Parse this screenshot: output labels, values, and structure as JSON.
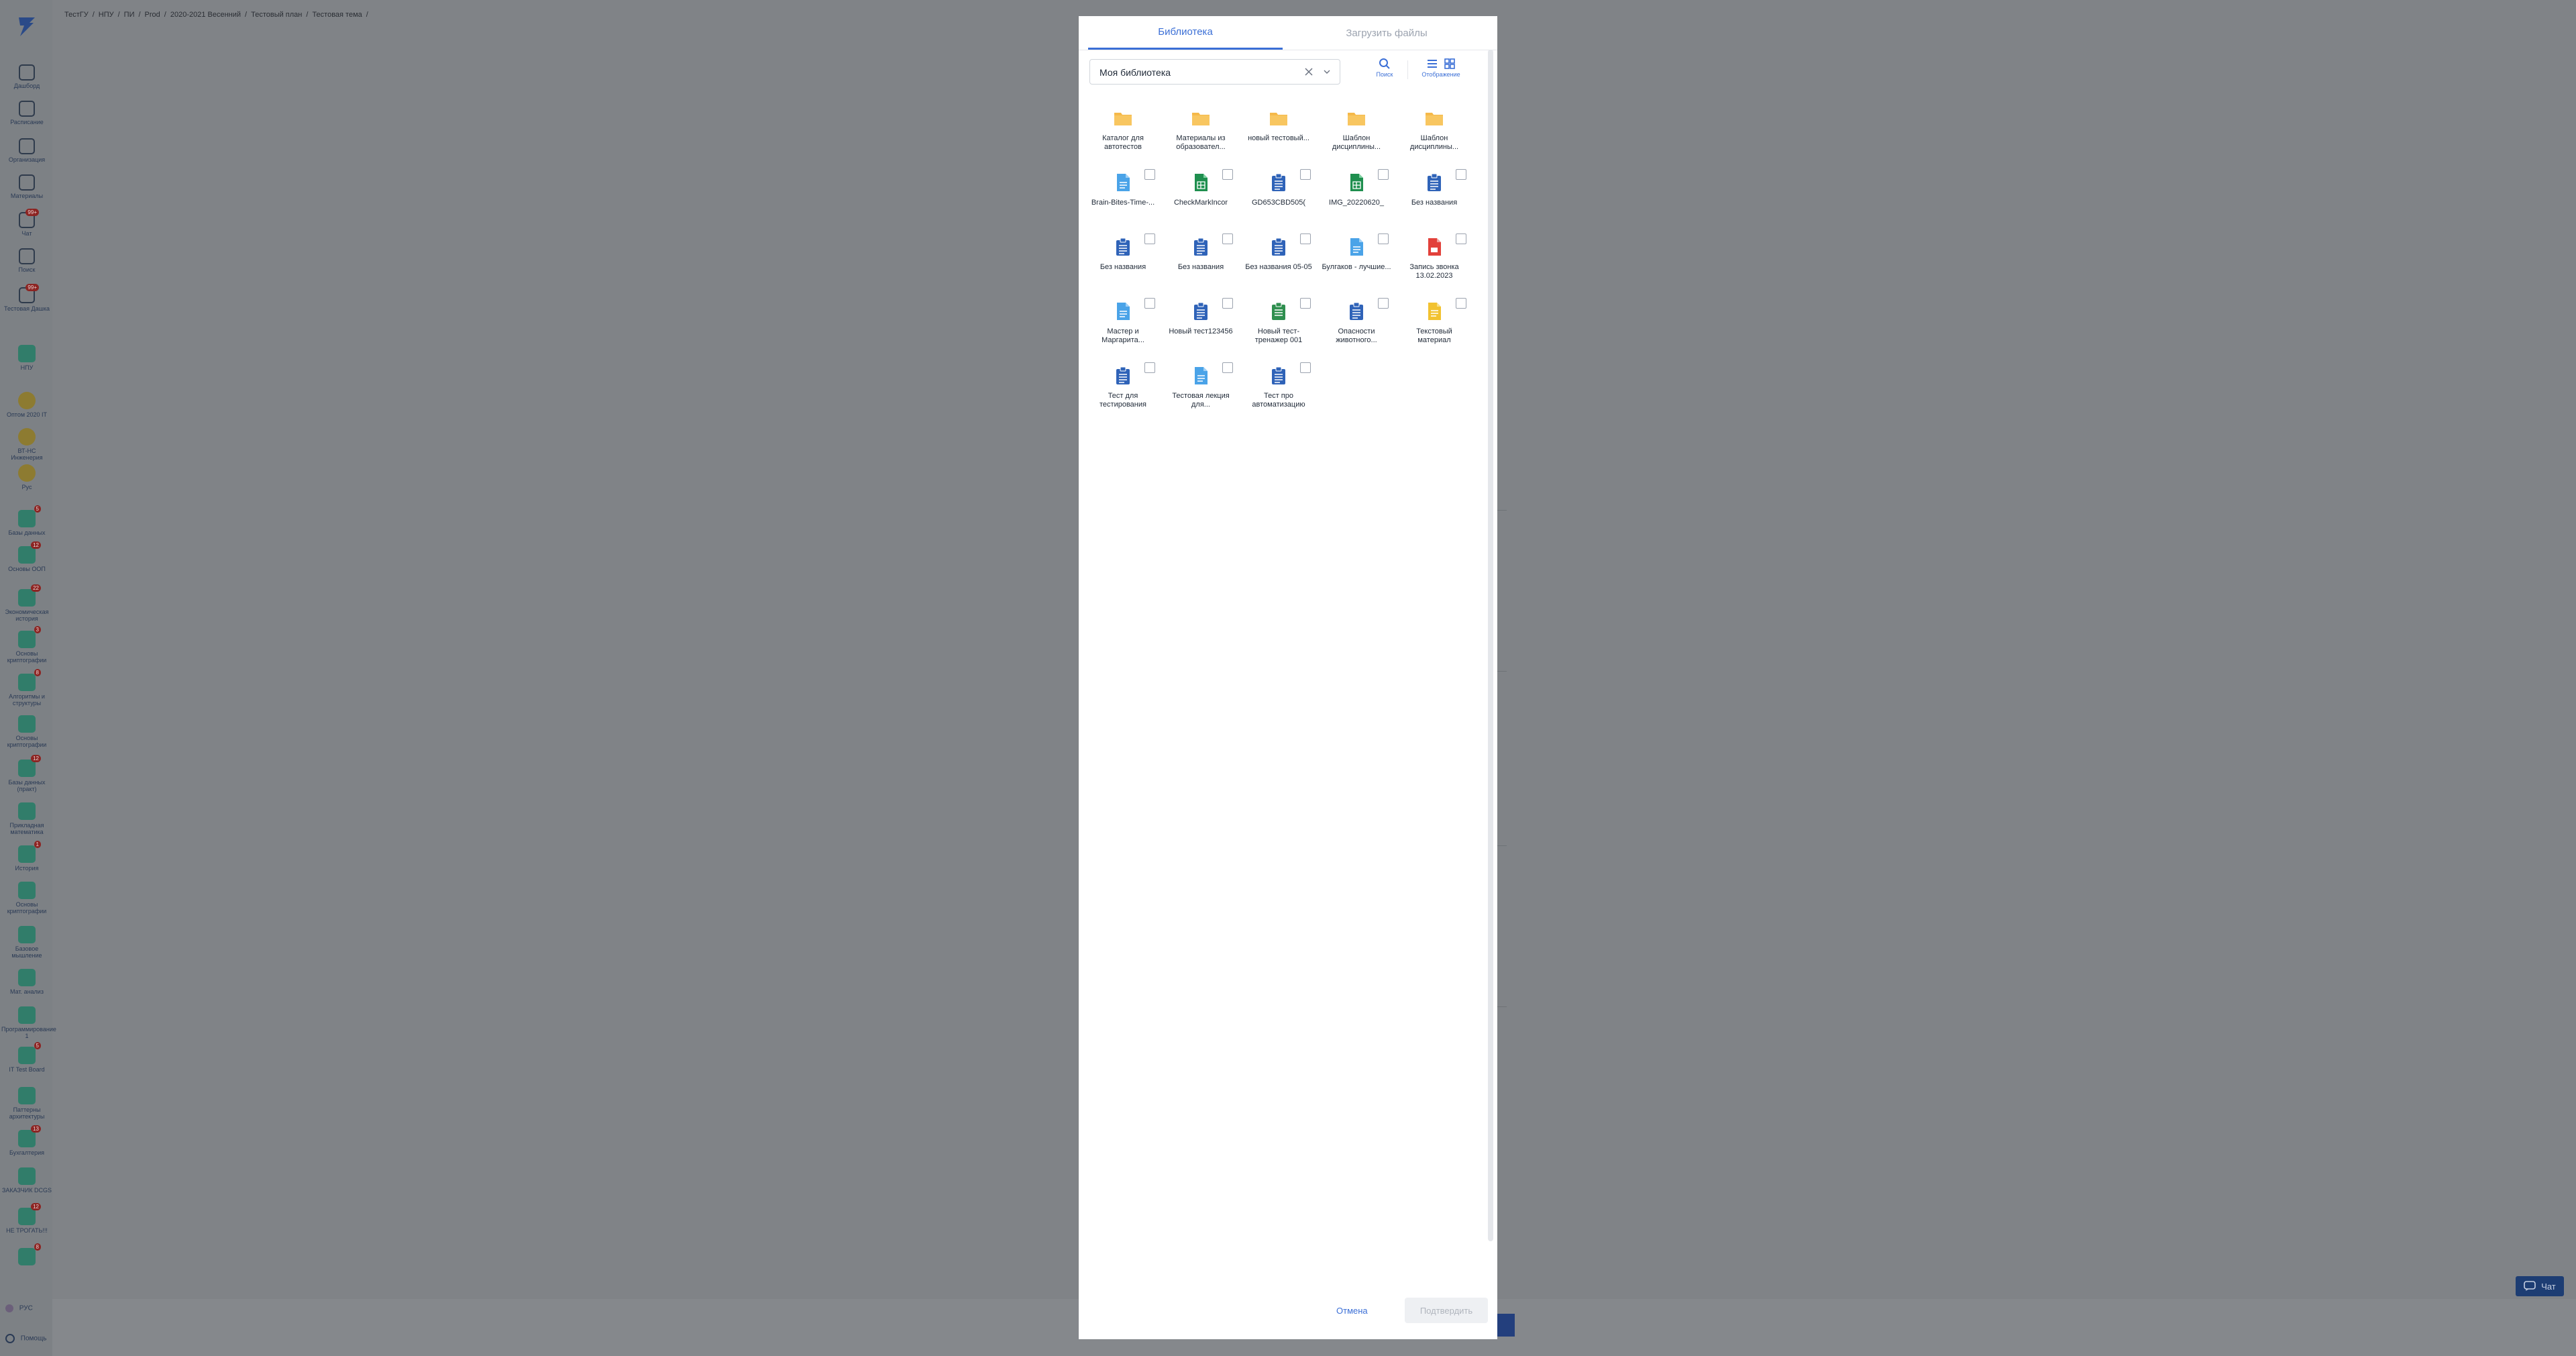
{
  "breadcrumb": [
    "ТестГУ",
    "/",
    "НПУ",
    "/",
    "ПИ",
    "/",
    "Prod",
    "/",
    "2020-2021 Весенний",
    "/",
    "Тестовый план",
    "/",
    "Тестовая тема",
    "/"
  ],
  "sidebar": {
    "items": [
      {
        "label": "Дашборд",
        "icon": "grid-icon",
        "badge": ""
      },
      {
        "label": "Расписание",
        "icon": "calendar-icon",
        "badge": ""
      },
      {
        "label": "Организация",
        "icon": "building-icon",
        "badge": ""
      },
      {
        "label": "Материалы",
        "icon": "book-icon",
        "badge": ""
      },
      {
        "label": "Чат",
        "icon": "chat-icon",
        "badge": "99+"
      },
      {
        "label": "Поиск",
        "icon": "search-icon",
        "badge": ""
      },
      {
        "label": "Тестовая Дашка",
        "icon": "course-icon",
        "badge": "99+"
      },
      {
        "label": "НПУ",
        "icon": "course-icon",
        "badge": ""
      },
      {
        "label": "Оптом 2020 IT",
        "icon": "course-icon",
        "badge": ""
      },
      {
        "label": "ВТ-НС Инженерия",
        "icon": "course-icon",
        "badge": ""
      },
      {
        "label": "Рус",
        "icon": "course-icon",
        "badge": ""
      },
      {
        "label": "Базы данных",
        "icon": "course-icon",
        "badge": "5"
      },
      {
        "label": "Основы ООП",
        "icon": "course-icon",
        "badge": "12"
      },
      {
        "label": "Экономическая история",
        "icon": "course-icon",
        "badge": "22"
      },
      {
        "label": "Основы криптографии",
        "icon": "course-icon",
        "badge": "3"
      },
      {
        "label": "Алгоритмы и структуры",
        "icon": "course-icon",
        "badge": "8"
      },
      {
        "label": "Основы криптографии",
        "icon": "course-icon",
        "badge": ""
      },
      {
        "label": "Базы данных (практ)",
        "icon": "course-icon",
        "badge": "12"
      },
      {
        "label": "Прикладная математика",
        "icon": "course-icon",
        "badge": ""
      },
      {
        "label": "История",
        "icon": "course-icon",
        "badge": "1"
      },
      {
        "label": "Основы криптографии",
        "icon": "course-icon",
        "badge": ""
      },
      {
        "label": "Базовое мышление",
        "icon": "course-icon",
        "badge": ""
      },
      {
        "label": "Мат. анализ",
        "icon": "course-icon",
        "badge": ""
      },
      {
        "label": "Программирование 1",
        "icon": "course-icon",
        "badge": ""
      },
      {
        "label": "IT Test Board",
        "icon": "course-icon",
        "badge": "5"
      },
      {
        "label": "Паттерны архитектуры",
        "icon": "course-icon",
        "badge": ""
      },
      {
        "label": "Бухгалтерия",
        "icon": "course-icon",
        "badge": "13"
      },
      {
        "label": "ЗАКАЗЧИК DCGS",
        "icon": "course-icon",
        "badge": ""
      },
      {
        "label": "НЕ ТРОГАТЬ!!!",
        "icon": "course-icon",
        "badge": "12"
      },
      {
        "label": "",
        "icon": "course-icon",
        "badge": "8"
      }
    ],
    "lang_label": "РУС",
    "help_label": "Помощь"
  },
  "chat_button": {
    "label": "Чат"
  },
  "dialog": {
    "tabs": [
      {
        "label": "Библиотека",
        "active": true
      },
      {
        "label": "Загрузить файлы",
        "active": false
      }
    ],
    "library_select": {
      "value": "Моя библиотека"
    },
    "search_label": "Поиск",
    "view_label": "Отображение",
    "items": [
      {
        "name": "Каталог для автотестов",
        "type": "folder"
      },
      {
        "name": "Материалы из образовател...",
        "type": "folder"
      },
      {
        "name": "новый тестовый...",
        "type": "folder"
      },
      {
        "name": "Шаблон дисциплины...",
        "type": "folder"
      },
      {
        "name": "Шаблон дисциплины...",
        "type": "folder"
      },
      {
        "name": "Brain-Bites-Time-...",
        "type": "doc"
      },
      {
        "name": "CheckMarkIncor",
        "type": "sheet"
      },
      {
        "name": "GD653CBD505(",
        "type": "test"
      },
      {
        "name": "IMG_20220620_",
        "type": "sheet"
      },
      {
        "name": "Без названия",
        "type": "test"
      },
      {
        "name": "Без названия",
        "type": "test"
      },
      {
        "name": "Без названия",
        "type": "test"
      },
      {
        "name": "Без названия 05-05",
        "type": "test"
      },
      {
        "name": "Булгаков - лучшие...",
        "type": "doc"
      },
      {
        "name": "Запись звонка 13.02.2023",
        "type": "pdf"
      },
      {
        "name": "Мастер и Маргарита...",
        "type": "doc"
      },
      {
        "name": "Новый тест123456",
        "type": "test"
      },
      {
        "name": "Новый тест-тренажер 001",
        "type": "trainer"
      },
      {
        "name": "Опасности животного...",
        "type": "test"
      },
      {
        "name": "Текстовый материал",
        "type": "text"
      },
      {
        "name": "Тест для тестирования",
        "type": "test"
      },
      {
        "name": "Тестовая лекция для...",
        "type": "doc"
      },
      {
        "name": "Тест про автоматизацию",
        "type": "test"
      }
    ],
    "cancel_label": "Отмена",
    "confirm_label": "Подтвердить",
    "accent_color": "#3b6fd6"
  }
}
